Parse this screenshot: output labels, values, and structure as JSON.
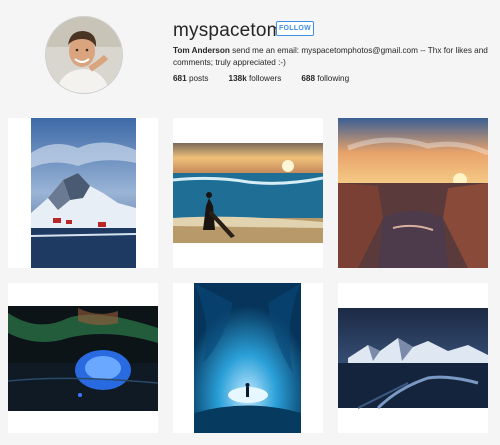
{
  "profile": {
    "username": "myspacetom",
    "follow_label": "FOLLOW",
    "full_name": "Tom Anderson",
    "bio_text": "send me an email: myspacetomphotos@gmail.com -- Thx for likes and comments; truly appreciated :-)"
  },
  "stats": {
    "posts_count": "681",
    "posts_label": "posts",
    "followers_count": "138k",
    "followers_label": "followers",
    "following_count": "688",
    "following_label": "following"
  },
  "posts": [
    {
      "subject": "snowy mountain village at dusk"
    },
    {
      "subject": "surfer silhouette at sunset beach"
    },
    {
      "subject": "sunset over rocky canyon"
    },
    {
      "subject": "glowing ice under aurora"
    },
    {
      "subject": "blue ice cave with figure"
    },
    {
      "subject": "snowy peaks over dark water"
    }
  ],
  "colors": {
    "accent": "#3f8ee6",
    "background": "#f5f5f5",
    "text": "#262626"
  }
}
